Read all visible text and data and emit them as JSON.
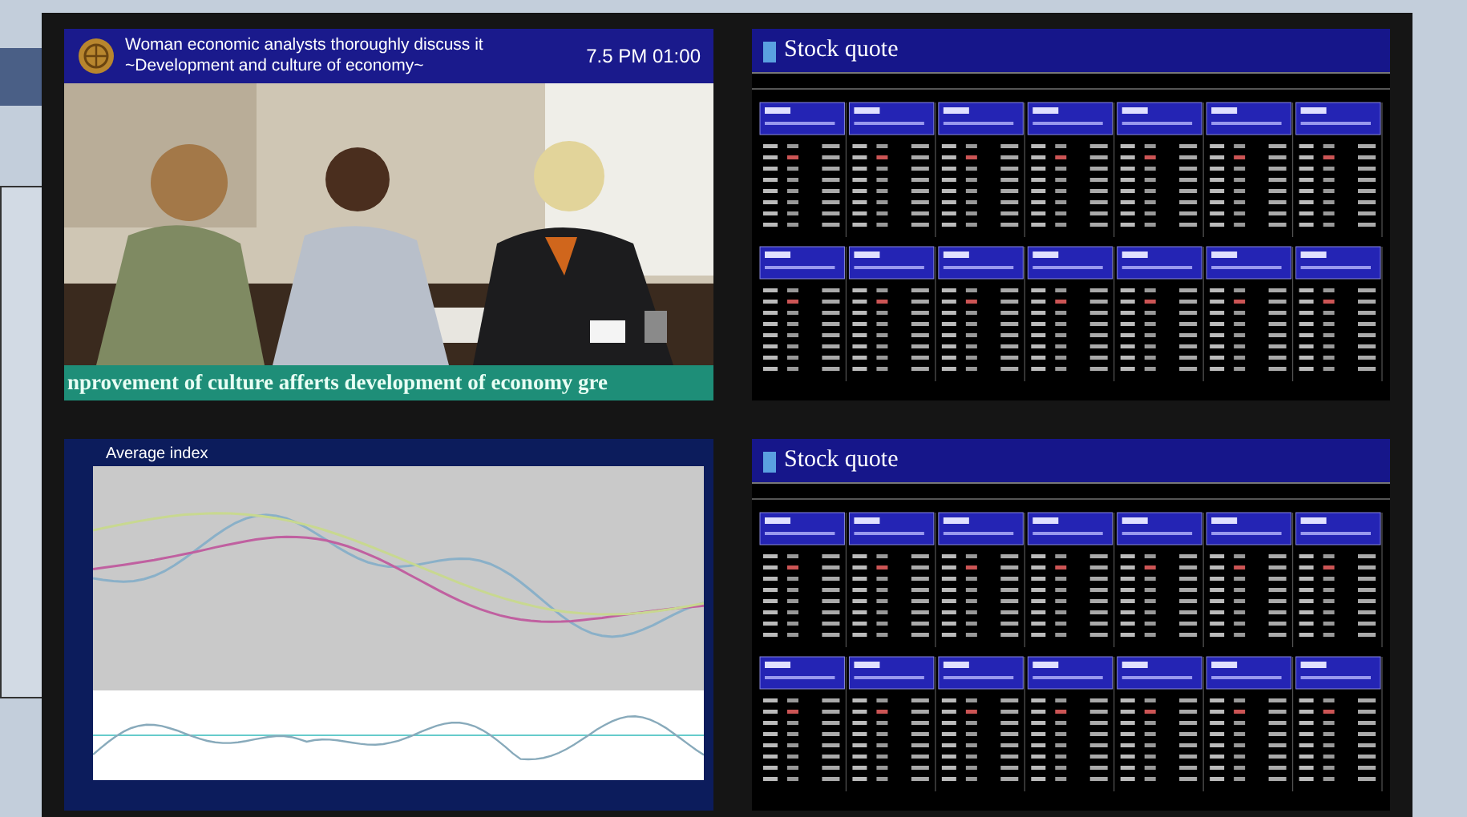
{
  "video_screen": {
    "title_lines": [
      "Woman economic analysts thoroughly discuss it",
      "~Development and culture of economy~"
    ],
    "time": "7.5 PM 01:00",
    "ticker": "nprovement of culture afferts development of economy gre",
    "kind": "picture"
  },
  "quote_screens": [
    {
      "title": "Stock quote"
    },
    {
      "title": "Stock quote"
    }
  ],
  "chart_screen": {
    "title": "Average index"
  }
}
